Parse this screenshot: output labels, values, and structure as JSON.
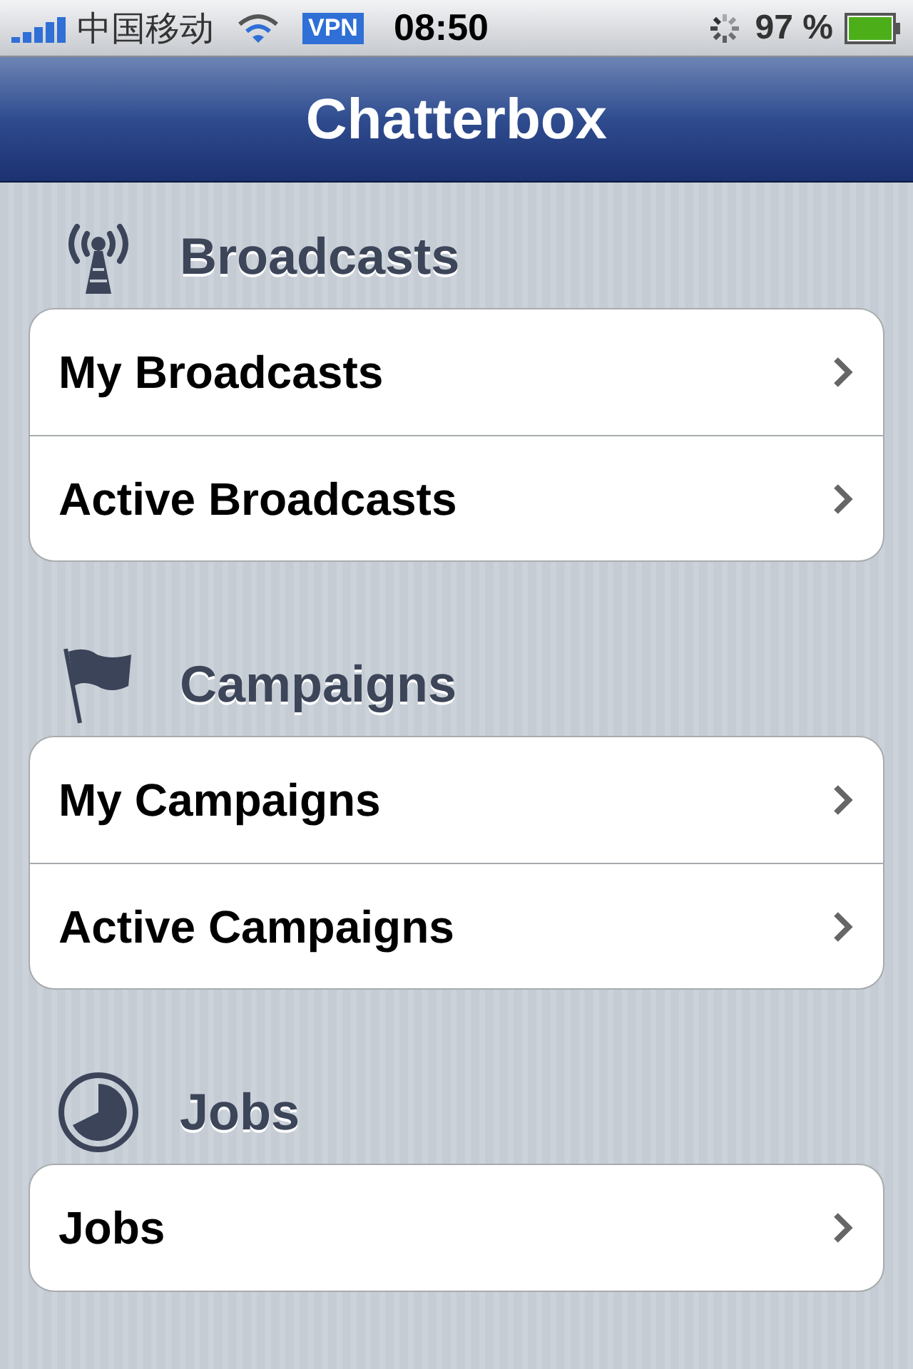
{
  "status_bar": {
    "carrier": "中国移动",
    "vpn": "VPN",
    "time": "08:50",
    "battery": "97 %"
  },
  "nav_bar": {
    "title": "Chatterbox"
  },
  "sections": [
    {
      "kind": "broadcast",
      "title": "Broadcasts",
      "items": [
        {
          "label": "My Broadcasts"
        },
        {
          "label": "Active Broadcasts"
        }
      ]
    },
    {
      "kind": "flag",
      "title": "Campaigns",
      "items": [
        {
          "label": "My Campaigns"
        },
        {
          "label": "Active Campaigns"
        }
      ]
    },
    {
      "kind": "clock",
      "title": "Jobs",
      "items": [
        {
          "label": "Jobs"
        }
      ]
    }
  ]
}
